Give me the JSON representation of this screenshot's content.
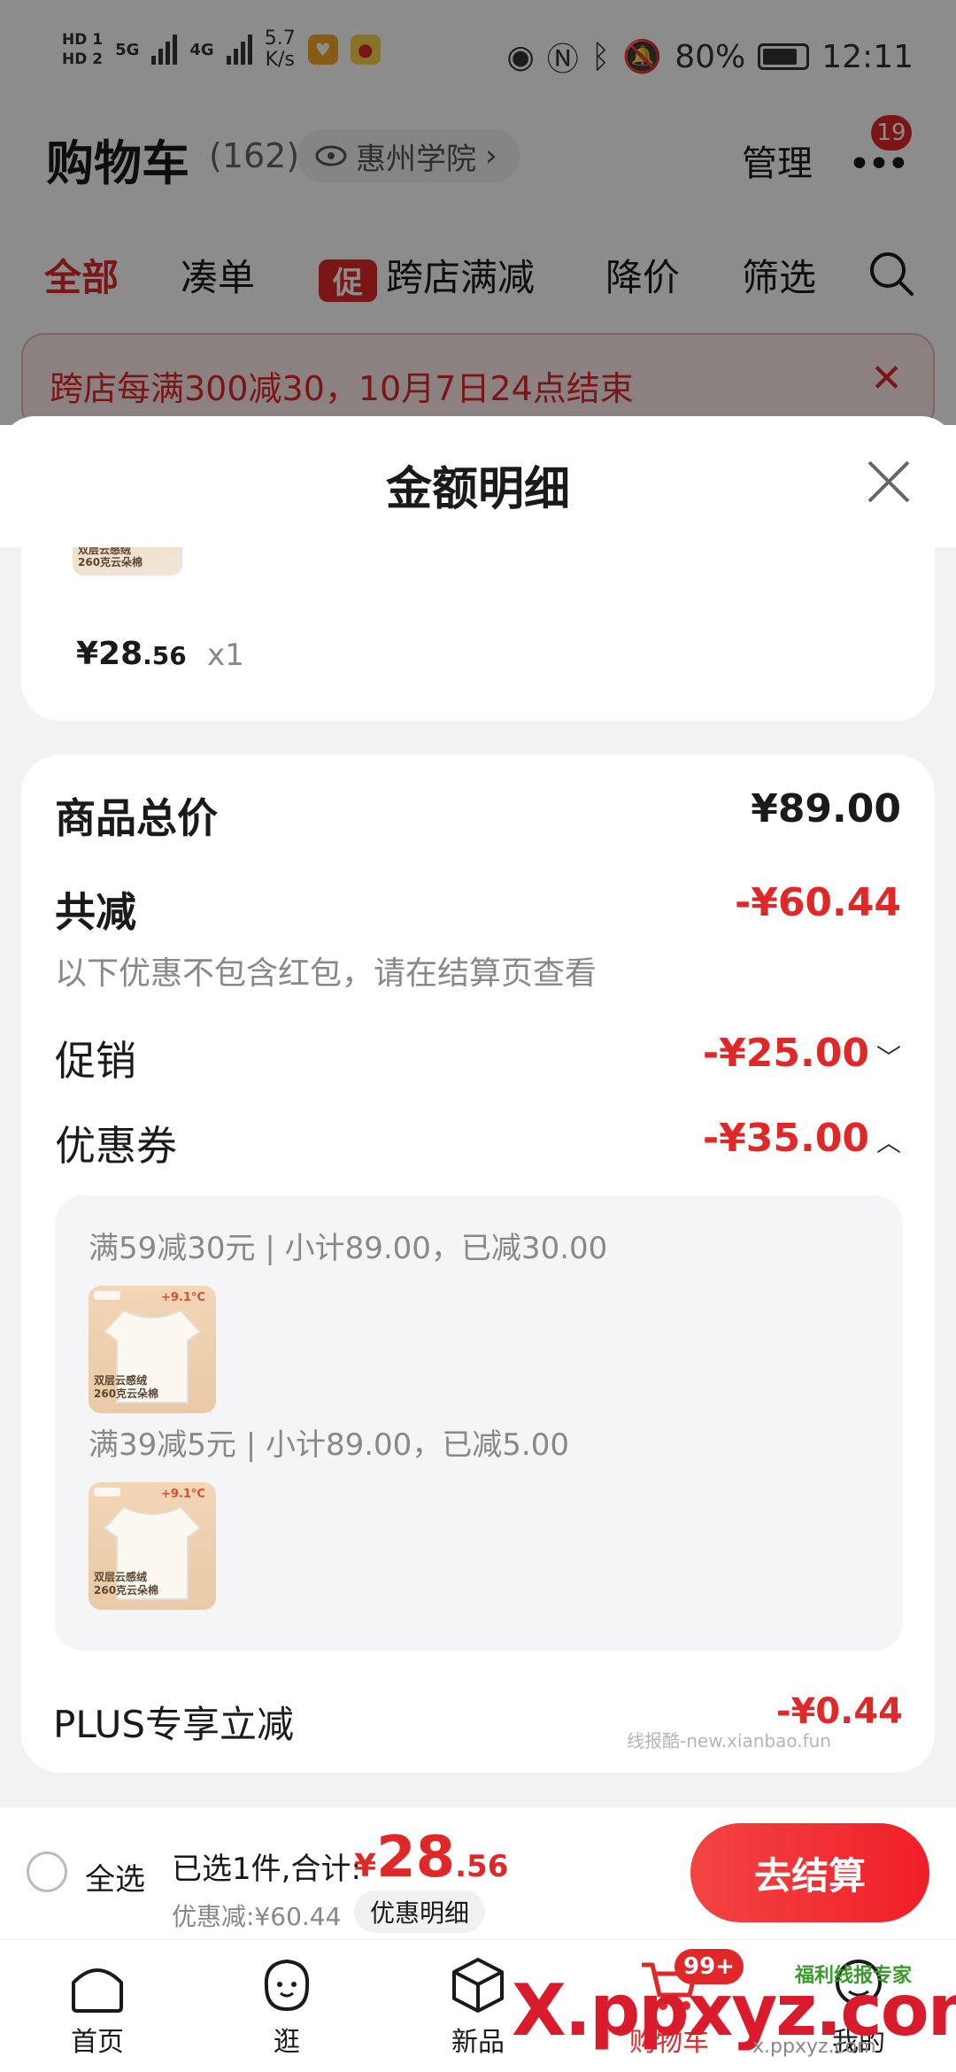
{
  "status_bar": {
    "hd1": "HD 1",
    "hd2": "HD 2",
    "net1": "5G",
    "net2": "4G",
    "speed_value": "5.7",
    "speed_unit": "K/s",
    "battery": "80%",
    "time": "12:11"
  },
  "header": {
    "title": "购物车",
    "count": "(162)",
    "location": "惠州学院",
    "manage": "管理",
    "more_badge": "19"
  },
  "tabs": [
    {
      "label": "全部",
      "active": true
    },
    {
      "label": "凑单"
    },
    {
      "label": "跨店满减",
      "chip": "促"
    },
    {
      "label": "降价"
    },
    {
      "label": "筛选"
    }
  ],
  "banner": {
    "text": "跨店每满300减30，10月7日24点结束"
  },
  "sheet": {
    "title": "金额明细",
    "thumb_line1": "双层云感绒",
    "thumb_line2": "260克云朵棉",
    "item_price_int": "¥28",
    "item_price_dec": ".56",
    "item_qty": "x1",
    "total_label": "商品总价",
    "total_value": "¥89.00",
    "reduce_label": "共减",
    "reduce_value": "-¥60.44",
    "note": "以下优惠不包含红包，请在结算页查看",
    "promo_label": "促销",
    "promo_value": "-¥25.00",
    "coupon_label": "优惠券",
    "coupon_value": "-¥35.00",
    "coupons": [
      {
        "text": "满59减30元 | 小计89.00，已减30.00"
      },
      {
        "text": "满39减5元 | 小计89.00，已减5.00"
      }
    ],
    "product_badge": "+9.1°C",
    "plus_label": "PLUS专享立减",
    "plus_value": "-¥0.44",
    "watermark": "线报酷-new.xianbao.fun"
  },
  "checkout": {
    "select_all": "全选",
    "summary": "已选1件,合计:",
    "total_currency": "¥",
    "total_int": "28",
    "total_dec": ".56",
    "discount": "优惠减:¥60.44",
    "detail": "优惠明细",
    "button": "去结算"
  },
  "nav": {
    "items": [
      {
        "label": "首页"
      },
      {
        "label": "逛"
      },
      {
        "label": "新品"
      },
      {
        "label": "购物车",
        "badge": "99+"
      },
      {
        "label": "我的"
      }
    ],
    "watermark_big": "X.ppxyz.com",
    "watermark_small": "x.ppxyz.com",
    "watermark_tag": "福利线报专家"
  },
  "colors": {
    "accent_red": "#e02828",
    "sheet_bg": "#f2f2f2"
  }
}
